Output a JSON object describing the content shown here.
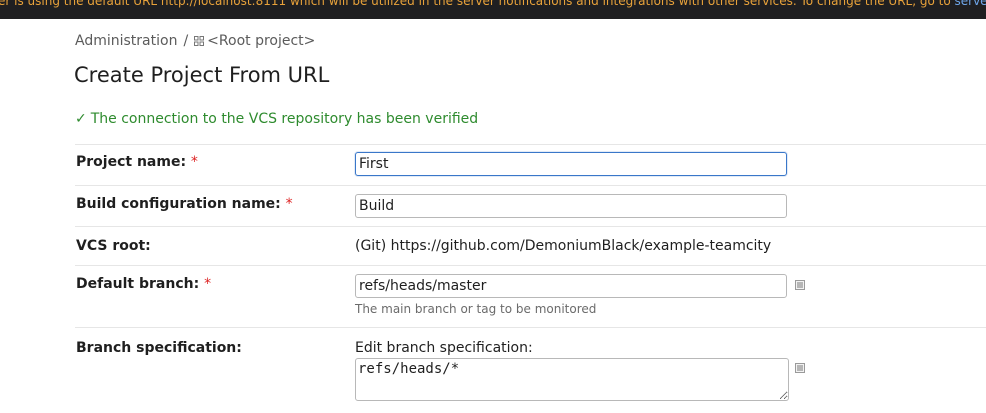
{
  "banner": {
    "text": "er is using the default URL http://localhost:8111 which will be utilized in the server notifications and integrations with other services. To change the URL, go to ",
    "link": "server settings."
  },
  "breadcrumb": {
    "admin": "Administration",
    "separator": "/",
    "project_icon": "project-icon",
    "root": "<Root project>"
  },
  "page": {
    "title": "Create Project From URL",
    "success_check": "✓",
    "success_message": "The connection to the VCS repository has been verified"
  },
  "form": {
    "required_mark": "*",
    "project_name": {
      "label": "Project name:",
      "value": "First"
    },
    "build_config": {
      "label": "Build configuration name:",
      "value": "Build"
    },
    "vcs_root": {
      "label": "VCS root:",
      "value": "(Git) https://github.com/DemoniumBlack/example-teamcity"
    },
    "default_branch": {
      "label": "Default branch:",
      "value": "refs/heads/master",
      "hint": "The main branch or tag to be monitored",
      "button_icon": "list-icon"
    },
    "branch_spec": {
      "label": "Branch specification:",
      "edit_label": "Edit branch specification:",
      "value": "refs/heads/*",
      "button_icon": "list-icon"
    }
  },
  "colors": {
    "success": "#2e8b2e",
    "required": "#dd2222",
    "focus": "#3a77c9",
    "banner_bg": "#1f1f21",
    "banner_text": "#e8a23a"
  }
}
